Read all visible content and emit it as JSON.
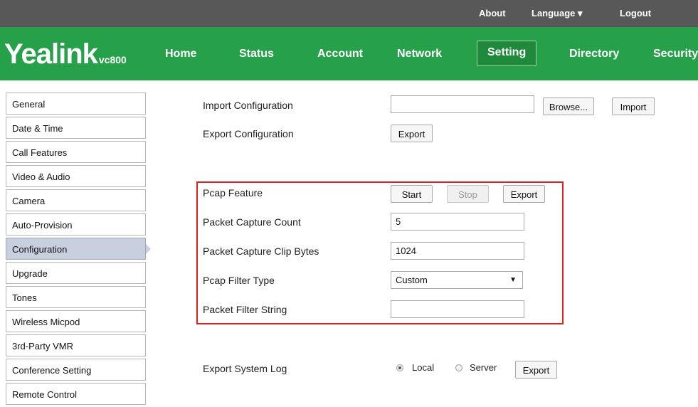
{
  "topbar": {
    "about": "About",
    "language": "Language ▾",
    "logout": "Logout"
  },
  "logo": {
    "brand": "Yealink",
    "model": "vc800"
  },
  "nav": {
    "items": [
      "Home",
      "Status",
      "Account",
      "Network",
      "Setting",
      "Directory",
      "Security"
    ],
    "active": "Setting"
  },
  "sidebar": {
    "items": [
      "General",
      "Date & Time",
      "Call Features",
      "Video & Audio",
      "Camera",
      "Auto-Provision",
      "Configuration",
      "Upgrade",
      "Tones",
      "Wireless Micpod",
      "3rd-Party VMR",
      "Conference Setting",
      "Remote Control"
    ],
    "active": "Configuration"
  },
  "main": {
    "import_label": "Import Configuration",
    "browse": "Browse...",
    "import": "Import",
    "export_label": "Export Configuration",
    "export": "Export",
    "pcap_label": "Pcap Feature",
    "start": "Start",
    "stop": "Stop",
    "pcap_export": "Export",
    "count_label": "Packet Capture Count",
    "count_value": "5",
    "clip_label": "Packet Capture Clip Bytes",
    "clip_value": "1024",
    "filter_type_label": "Pcap Filter Type",
    "filter_type_value": "Custom",
    "filter_string_label": "Packet Filter String",
    "filter_string_value": "",
    "syslog_label": "Export System Log",
    "local": "Local",
    "server": "Server",
    "syslog_export": "Export"
  },
  "colors": {
    "nav_green": "#27a04a",
    "topbar": "#585858",
    "highlight_box": "#e02020"
  }
}
